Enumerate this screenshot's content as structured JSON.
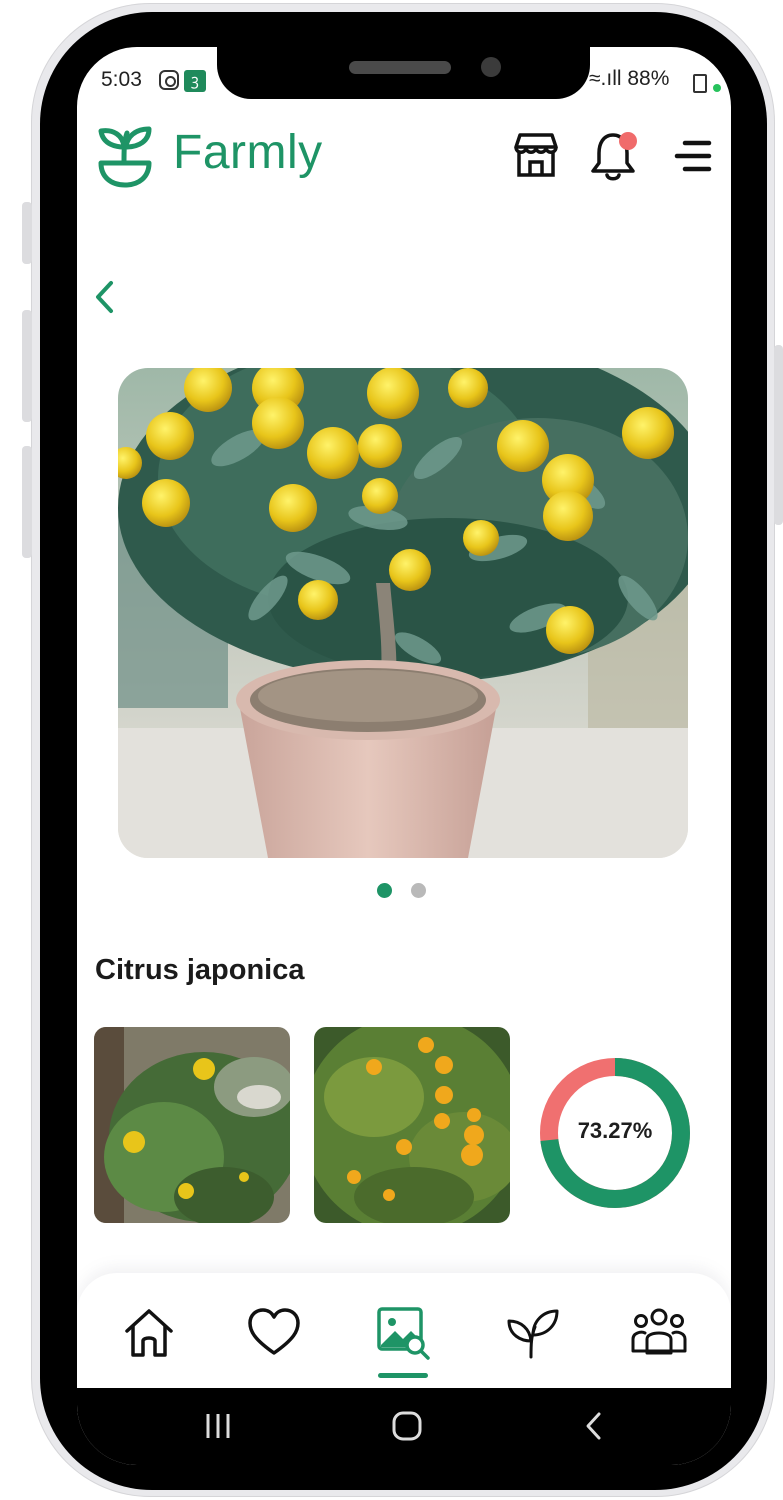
{
  "status_bar": {
    "time": "5:03",
    "app_badge": "ꝫ",
    "signal_battery": "≈.ıll 88%"
  },
  "header": {
    "brand": "Farmly",
    "icons": [
      "store-icon",
      "bell-icon",
      "menu-icon"
    ]
  },
  "plant": {
    "name": "Citrus japonica",
    "confidence_percent": 73.27,
    "confidence_label": "73.27%"
  },
  "carousel": {
    "page_count": 2,
    "active_index": 0
  },
  "bottom_nav": {
    "items": [
      "home-icon",
      "heart-icon",
      "image-search-icon",
      "plant-icon",
      "community-icon"
    ],
    "active_index": 2
  },
  "colors": {
    "brand_green": "#1e9466",
    "notification_red": "#f06b6b",
    "donut_remainder": "#f07070",
    "inactive_dot": "#b9b9b9"
  }
}
